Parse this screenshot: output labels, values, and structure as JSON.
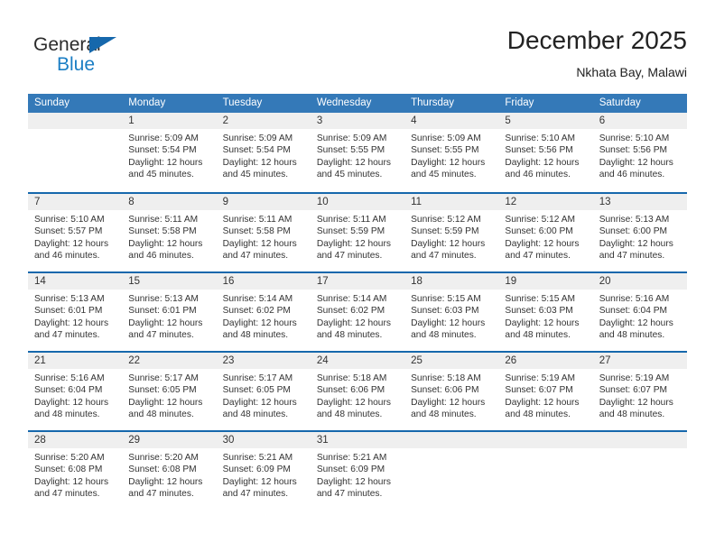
{
  "brand": {
    "name_part1": "General",
    "name_part2": "Blue",
    "triangle_color": "#1668ac",
    "blue_text_color": "#1b7ec4"
  },
  "header": {
    "title": "December 2025",
    "subtitle": "Nkhata Bay, Malawi"
  },
  "theme": {
    "header_row_bg": "#3479b8",
    "week_separator": "#1668ac",
    "day_number_band": "#efefef",
    "text": "#333333"
  },
  "calendar": {
    "weekday_headers": [
      "Sunday",
      "Monday",
      "Tuesday",
      "Wednesday",
      "Thursday",
      "Friday",
      "Saturday"
    ],
    "weeks": [
      [
        {
          "day": "",
          "lines": []
        },
        {
          "day": "1",
          "lines": [
            "Sunrise: 5:09 AM",
            "Sunset: 5:54 PM",
            "Daylight: 12 hours",
            "and 45 minutes."
          ]
        },
        {
          "day": "2",
          "lines": [
            "Sunrise: 5:09 AM",
            "Sunset: 5:54 PM",
            "Daylight: 12 hours",
            "and 45 minutes."
          ]
        },
        {
          "day": "3",
          "lines": [
            "Sunrise: 5:09 AM",
            "Sunset: 5:55 PM",
            "Daylight: 12 hours",
            "and 45 minutes."
          ]
        },
        {
          "day": "4",
          "lines": [
            "Sunrise: 5:09 AM",
            "Sunset: 5:55 PM",
            "Daylight: 12 hours",
            "and 45 minutes."
          ]
        },
        {
          "day": "5",
          "lines": [
            "Sunrise: 5:10 AM",
            "Sunset: 5:56 PM",
            "Daylight: 12 hours",
            "and 46 minutes."
          ]
        },
        {
          "day": "6",
          "lines": [
            "Sunrise: 5:10 AM",
            "Sunset: 5:56 PM",
            "Daylight: 12 hours",
            "and 46 minutes."
          ]
        }
      ],
      [
        {
          "day": "7",
          "lines": [
            "Sunrise: 5:10 AM",
            "Sunset: 5:57 PM",
            "Daylight: 12 hours",
            "and 46 minutes."
          ]
        },
        {
          "day": "8",
          "lines": [
            "Sunrise: 5:11 AM",
            "Sunset: 5:58 PM",
            "Daylight: 12 hours",
            "and 46 minutes."
          ]
        },
        {
          "day": "9",
          "lines": [
            "Sunrise: 5:11 AM",
            "Sunset: 5:58 PM",
            "Daylight: 12 hours",
            "and 47 minutes."
          ]
        },
        {
          "day": "10",
          "lines": [
            "Sunrise: 5:11 AM",
            "Sunset: 5:59 PM",
            "Daylight: 12 hours",
            "and 47 minutes."
          ]
        },
        {
          "day": "11",
          "lines": [
            "Sunrise: 5:12 AM",
            "Sunset: 5:59 PM",
            "Daylight: 12 hours",
            "and 47 minutes."
          ]
        },
        {
          "day": "12",
          "lines": [
            "Sunrise: 5:12 AM",
            "Sunset: 6:00 PM",
            "Daylight: 12 hours",
            "and 47 minutes."
          ]
        },
        {
          "day": "13",
          "lines": [
            "Sunrise: 5:13 AM",
            "Sunset: 6:00 PM",
            "Daylight: 12 hours",
            "and 47 minutes."
          ]
        }
      ],
      [
        {
          "day": "14",
          "lines": [
            "Sunrise: 5:13 AM",
            "Sunset: 6:01 PM",
            "Daylight: 12 hours",
            "and 47 minutes."
          ]
        },
        {
          "day": "15",
          "lines": [
            "Sunrise: 5:13 AM",
            "Sunset: 6:01 PM",
            "Daylight: 12 hours",
            "and 47 minutes."
          ]
        },
        {
          "day": "16",
          "lines": [
            "Sunrise: 5:14 AM",
            "Sunset: 6:02 PM",
            "Daylight: 12 hours",
            "and 48 minutes."
          ]
        },
        {
          "day": "17",
          "lines": [
            "Sunrise: 5:14 AM",
            "Sunset: 6:02 PM",
            "Daylight: 12 hours",
            "and 48 minutes."
          ]
        },
        {
          "day": "18",
          "lines": [
            "Sunrise: 5:15 AM",
            "Sunset: 6:03 PM",
            "Daylight: 12 hours",
            "and 48 minutes."
          ]
        },
        {
          "day": "19",
          "lines": [
            "Sunrise: 5:15 AM",
            "Sunset: 6:03 PM",
            "Daylight: 12 hours",
            "and 48 minutes."
          ]
        },
        {
          "day": "20",
          "lines": [
            "Sunrise: 5:16 AM",
            "Sunset: 6:04 PM",
            "Daylight: 12 hours",
            "and 48 minutes."
          ]
        }
      ],
      [
        {
          "day": "21",
          "lines": [
            "Sunrise: 5:16 AM",
            "Sunset: 6:04 PM",
            "Daylight: 12 hours",
            "and 48 minutes."
          ]
        },
        {
          "day": "22",
          "lines": [
            "Sunrise: 5:17 AM",
            "Sunset: 6:05 PM",
            "Daylight: 12 hours",
            "and 48 minutes."
          ]
        },
        {
          "day": "23",
          "lines": [
            "Sunrise: 5:17 AM",
            "Sunset: 6:05 PM",
            "Daylight: 12 hours",
            "and 48 minutes."
          ]
        },
        {
          "day": "24",
          "lines": [
            "Sunrise: 5:18 AM",
            "Sunset: 6:06 PM",
            "Daylight: 12 hours",
            "and 48 minutes."
          ]
        },
        {
          "day": "25",
          "lines": [
            "Sunrise: 5:18 AM",
            "Sunset: 6:06 PM",
            "Daylight: 12 hours",
            "and 48 minutes."
          ]
        },
        {
          "day": "26",
          "lines": [
            "Sunrise: 5:19 AM",
            "Sunset: 6:07 PM",
            "Daylight: 12 hours",
            "and 48 minutes."
          ]
        },
        {
          "day": "27",
          "lines": [
            "Sunrise: 5:19 AM",
            "Sunset: 6:07 PM",
            "Daylight: 12 hours",
            "and 48 minutes."
          ]
        }
      ],
      [
        {
          "day": "28",
          "lines": [
            "Sunrise: 5:20 AM",
            "Sunset: 6:08 PM",
            "Daylight: 12 hours",
            "and 47 minutes."
          ]
        },
        {
          "day": "29",
          "lines": [
            "Sunrise: 5:20 AM",
            "Sunset: 6:08 PM",
            "Daylight: 12 hours",
            "and 47 minutes."
          ]
        },
        {
          "day": "30",
          "lines": [
            "Sunrise: 5:21 AM",
            "Sunset: 6:09 PM",
            "Daylight: 12 hours",
            "and 47 minutes."
          ]
        },
        {
          "day": "31",
          "lines": [
            "Sunrise: 5:21 AM",
            "Sunset: 6:09 PM",
            "Daylight: 12 hours",
            "and 47 minutes."
          ]
        },
        {
          "day": "",
          "lines": []
        },
        {
          "day": "",
          "lines": []
        },
        {
          "day": "",
          "lines": []
        }
      ]
    ]
  }
}
